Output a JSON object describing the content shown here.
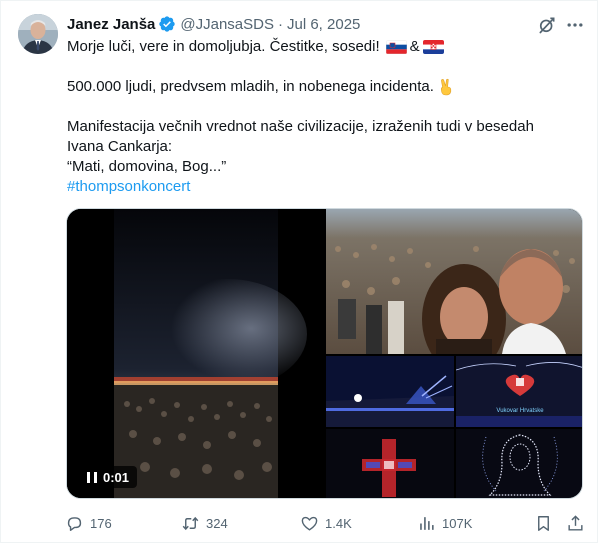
{
  "author": {
    "name": "Janez Janša",
    "handle": "@JJansaSDS",
    "separator": "·",
    "date": "Jul 6, 2025",
    "verified": true
  },
  "icons": {
    "verified": "verified-badge-icon",
    "grok": "grok-icon",
    "more": "more-options-icon",
    "reply": "reply-icon",
    "repost": "repost-icon",
    "like": "like-icon",
    "views": "views-icon",
    "bookmark": "bookmark-icon",
    "share": "share-icon",
    "pause": "pause-icon"
  },
  "text": {
    "line1": "Morje luči, vere in domoljubja. Čestitke, sosedi!",
    "line1_amp": "&",
    "line2": "500.000 ljudi, predvsem mladih, in nobenega incidenta.",
    "line3": "Manifestacija večnih vrednot naše civilizacije, izraženih tudi v besedah",
    "line4": "Ivana Cankarja:",
    "line5": "“Mati, domovina, Bog...”",
    "hashtag": "#thompsonkoncert"
  },
  "media": {
    "video_time": "0:01",
    "photo_caption": "Vukovar Hrvatske"
  },
  "stats": {
    "replies": "176",
    "reposts": "324",
    "likes": "1.4K",
    "views": "107K"
  },
  "colors": {
    "accent": "#1d9bf0",
    "muted": "#536471",
    "text": "#0f1419"
  }
}
